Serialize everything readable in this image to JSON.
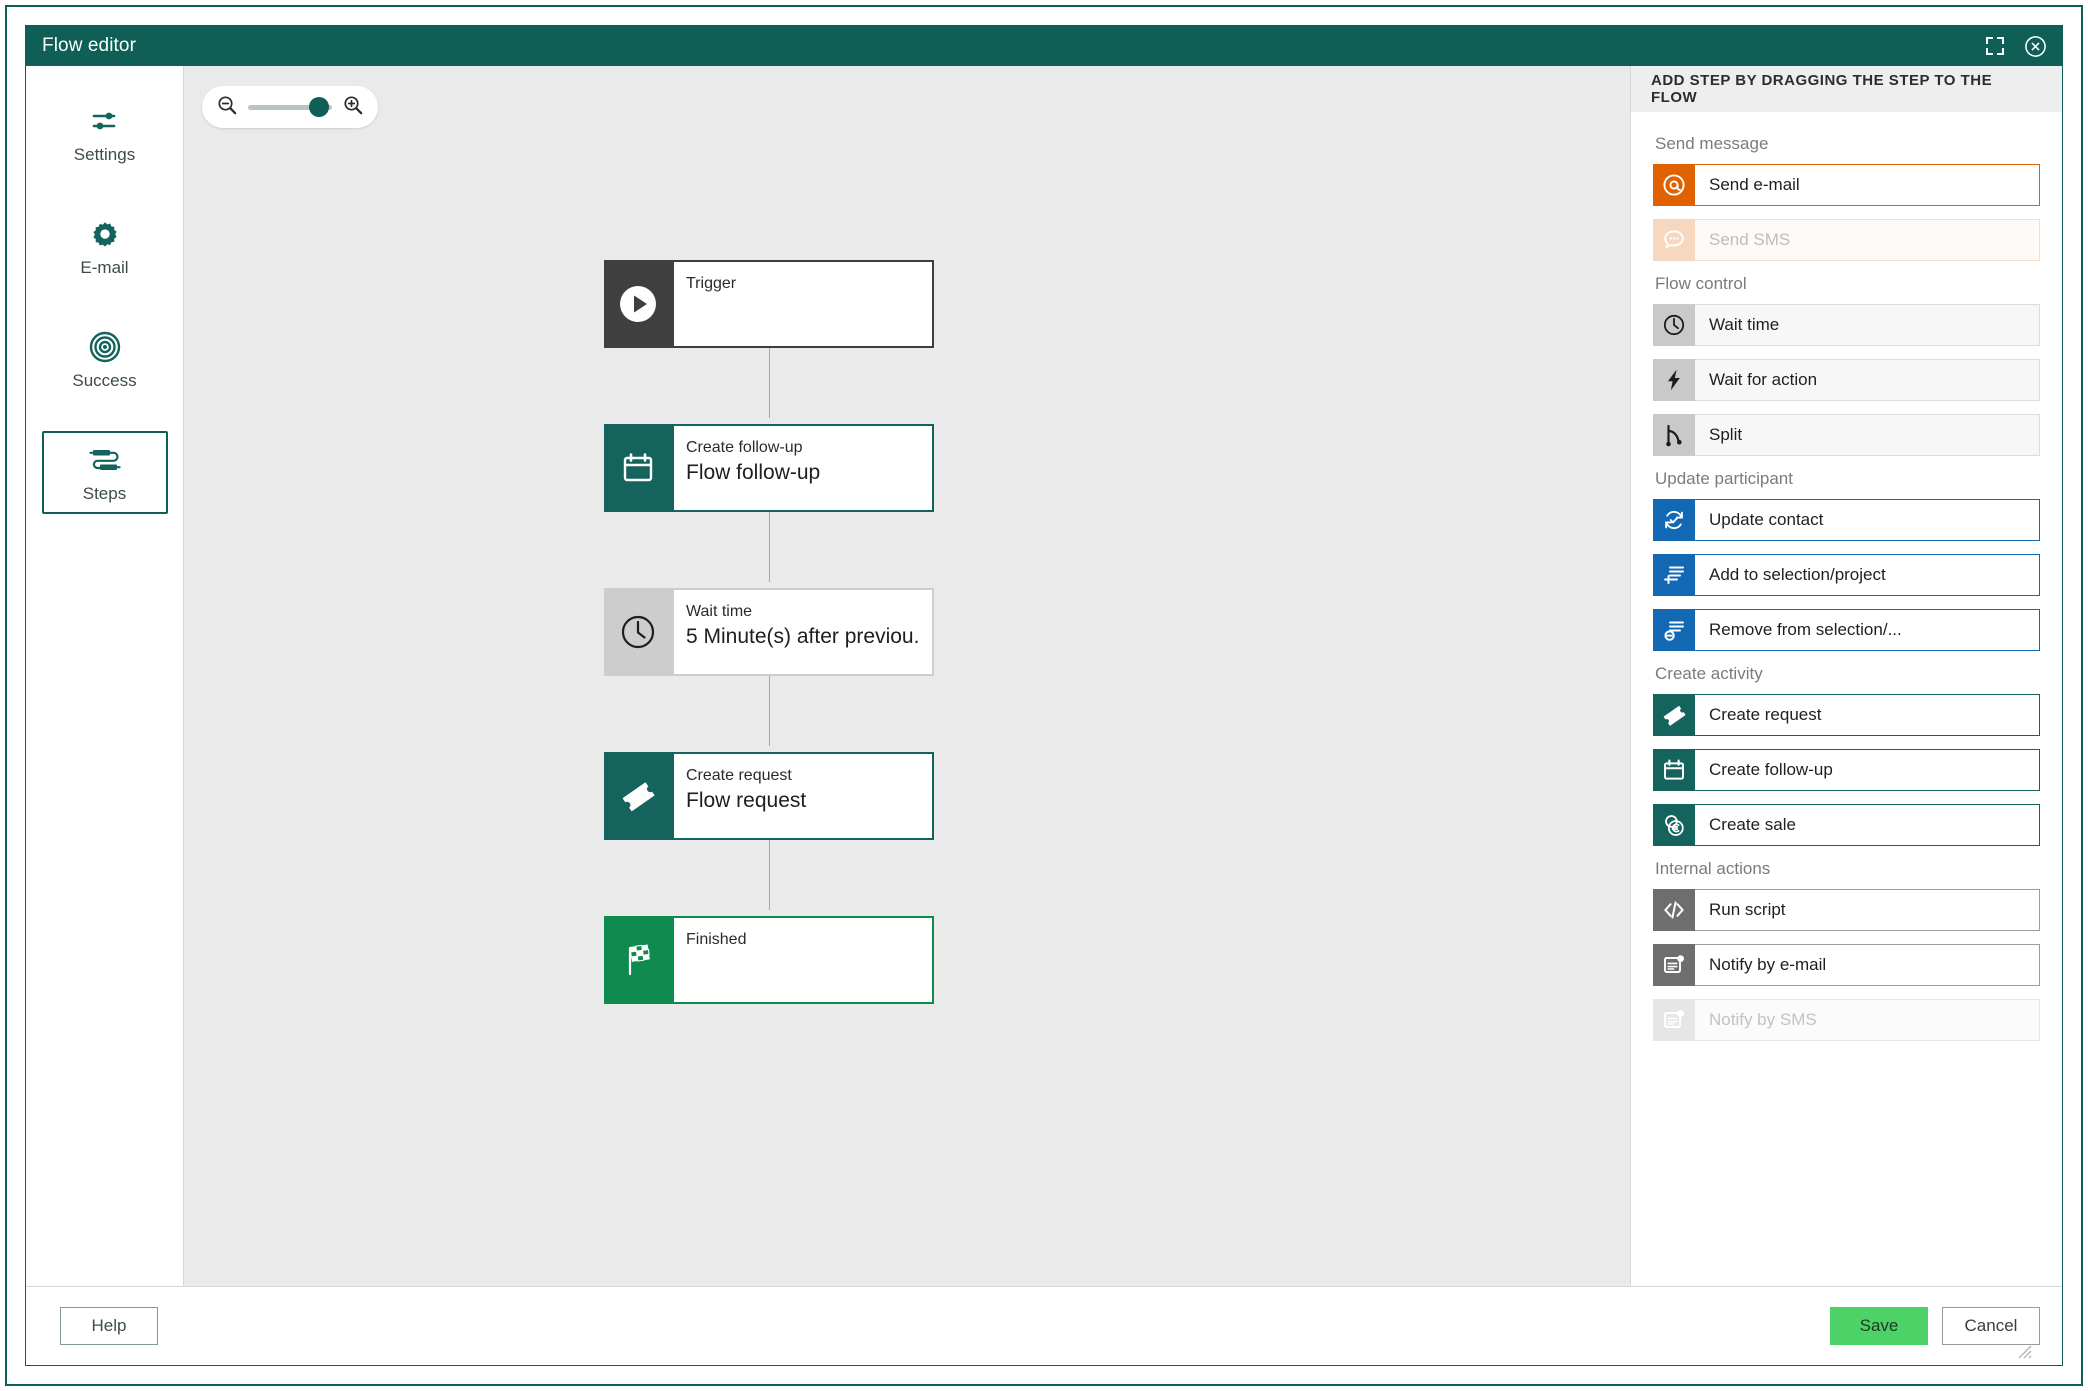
{
  "window": {
    "title": "Flow editor",
    "accent_color": "#0f5f57",
    "maximize_icon": "expand-icon",
    "close_icon": "close-circle-icon"
  },
  "sidebar": {
    "items": [
      {
        "label": "Settings",
        "icon": "sliders-icon",
        "selected": false
      },
      {
        "label": "E-mail",
        "icon": "gear-icon",
        "selected": false
      },
      {
        "label": "Success",
        "icon": "target-icon",
        "selected": false
      },
      {
        "label": "Steps",
        "icon": "steps-icon",
        "selected": true
      }
    ]
  },
  "canvas": {
    "zoom": {
      "out_icon": "zoom-out-icon",
      "in_icon": "zoom-in-icon",
      "value_percent": 85
    },
    "nodes": [
      {
        "title": "Trigger",
        "subtitle": "",
        "icon": "play-circle-icon",
        "style": "trigger"
      },
      {
        "title": "Create follow-up",
        "subtitle": "Flow follow-up",
        "icon": "calendar-icon",
        "style": "teal"
      },
      {
        "title": "Wait time",
        "subtitle": "5 Minute(s) after previou...",
        "icon": "clock-icon",
        "style": "gray"
      },
      {
        "title": "Create request",
        "subtitle": "Flow request",
        "icon": "ticket-icon",
        "style": "teal"
      },
      {
        "title": "Finished",
        "subtitle": "",
        "icon": "checkered-flag-icon",
        "style": "green"
      }
    ]
  },
  "right_panel": {
    "header": "ADD STEP BY DRAGGING THE STEP TO THE FLOW",
    "groups": [
      {
        "title": "Send message",
        "items": [
          {
            "label": "Send e-mail",
            "icon": "at-sign-icon",
            "variant": "orange",
            "disabled": false
          },
          {
            "label": "Send SMS",
            "icon": "chat-bubble-icon",
            "variant": "orange-dis",
            "disabled": true
          }
        ]
      },
      {
        "title": "Flow control",
        "items": [
          {
            "label": "Wait time",
            "icon": "clock-icon",
            "variant": "gray",
            "disabled": false
          },
          {
            "label": "Wait for action",
            "icon": "lightning-icon",
            "variant": "gray",
            "disabled": false
          },
          {
            "label": "Split",
            "icon": "split-branch-icon",
            "variant": "gray",
            "disabled": false
          }
        ]
      },
      {
        "title": "Update participant",
        "items": [
          {
            "label": "Update contact",
            "icon": "refresh-check-icon",
            "variant": "blue",
            "disabled": false
          },
          {
            "label": "Add to selection/project",
            "icon": "list-add-icon",
            "variant": "blue",
            "disabled": false
          },
          {
            "label": "Remove from selection/...",
            "icon": "list-remove-icon",
            "variant": "blue",
            "disabled": false
          }
        ]
      },
      {
        "title": "Create activity",
        "items": [
          {
            "label": "Create request",
            "icon": "ticket-icon",
            "variant": "teal",
            "disabled": false
          },
          {
            "label": "Create follow-up",
            "icon": "calendar-icon",
            "variant": "teal",
            "disabled": false
          },
          {
            "label": "Create sale",
            "icon": "coins-euro-icon",
            "variant": "teal",
            "disabled": false
          }
        ]
      },
      {
        "title": "Internal actions",
        "items": [
          {
            "label": "Run script",
            "icon": "code-brackets-icon",
            "variant": "dgray",
            "disabled": false
          },
          {
            "label": "Notify by e-mail",
            "icon": "notify-mail-icon",
            "variant": "dgray",
            "disabled": false
          },
          {
            "label": "Notify by SMS",
            "icon": "notify-sms-icon",
            "variant": "dgray-dis",
            "disabled": true
          }
        ]
      }
    ]
  },
  "footer": {
    "help_label": "Help",
    "save_label": "Save",
    "cancel_label": "Cancel",
    "resize_grip": "resize-grip-icon"
  }
}
